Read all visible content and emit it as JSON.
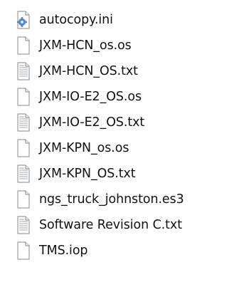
{
  "files": [
    {
      "name": "autocopy.ini",
      "icon": "settings-file-icon"
    },
    {
      "name": "JXM-HCN_os.os",
      "icon": "blank-file-icon"
    },
    {
      "name": "JXM-HCN_OS.txt",
      "icon": "text-file-icon"
    },
    {
      "name": "JXM-IO-E2_OS.os",
      "icon": "blank-file-icon"
    },
    {
      "name": "JXM-IO-E2_OS.txt",
      "icon": "text-file-icon"
    },
    {
      "name": "JXM-KPN_os.os",
      "icon": "blank-file-icon"
    },
    {
      "name": "JXM-KPN_OS.txt",
      "icon": "text-file-icon"
    },
    {
      "name": "ngs_truck_johnston.es3",
      "icon": "blank-file-icon"
    },
    {
      "name": "Software Revision C.txt",
      "icon": "text-file-icon"
    },
    {
      "name": "TMS.iop",
      "icon": "blank-file-icon"
    }
  ],
  "colors": {
    "icon_outline": "#8a8a8a",
    "icon_fill": "#ffffff",
    "text_lines": "#9aa8b8",
    "gear_blue": "#5b86c5",
    "text": "#111111"
  }
}
